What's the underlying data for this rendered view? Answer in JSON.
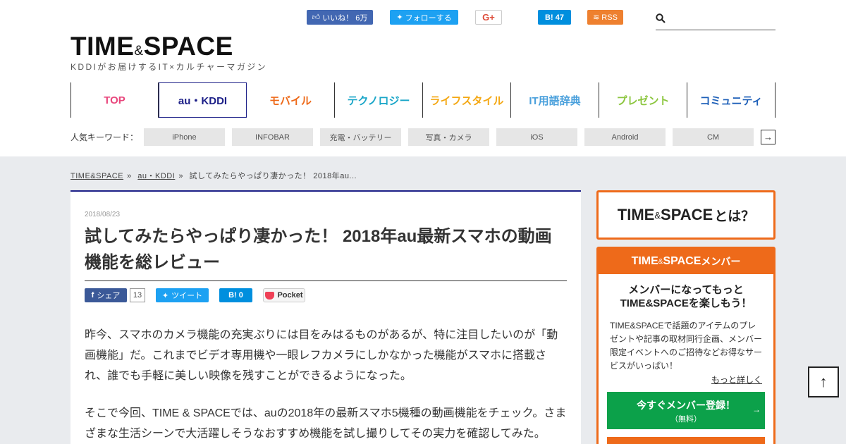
{
  "social_top": {
    "fb_like": "いいね！ 6万",
    "twitter_follow": "フォローする",
    "gplus": "G+",
    "hatena": "B! 47",
    "rss": "RSS"
  },
  "search": {
    "placeholder": ""
  },
  "logo": {
    "part1": "TIME",
    "amp": "&",
    "part2": "SPACE"
  },
  "tagline": "KDDIがお届けするIT×カルチャーマガジン",
  "nav": [
    {
      "label": "TOP",
      "color": "#e8467c"
    },
    {
      "label": "au・KDDI",
      "color": "#1d2088"
    },
    {
      "label": "モバイル",
      "color": "#ee6a1a"
    },
    {
      "label": "テクノロジー",
      "color": "#1aa6c8"
    },
    {
      "label": "ライフスタイル",
      "color": "#f4a814"
    },
    {
      "label": "IT用語辞典",
      "color": "#4aa0dc"
    },
    {
      "label": "プレゼント",
      "color": "#8cc63f"
    },
    {
      "label": "コミュニティ",
      "color": "#1d5fb8"
    }
  ],
  "keywords": {
    "label": "人気キーワード：",
    "tags": [
      "iPhone",
      "INFOBAR",
      "充電・バッテリー",
      "写真・カメラ",
      "iOS",
      "Android",
      "CM"
    ],
    "more": "→"
  },
  "breadcrumb": {
    "home": "TIME&SPACE",
    "category": "au・KDDI",
    "current": "試してみたらやっぱり凄かった！ 2018年au...",
    "sep": "»"
  },
  "article": {
    "date": "2018/08/23",
    "title": "試してみたらやっぱり凄かった！ 2018年au最新スマホの動画機能を総レビュー",
    "share": {
      "fb": "シェア",
      "fb_count": "13",
      "tw": "ツイート",
      "hatena": "B!  0",
      "pocket": "Pocket"
    },
    "paragraphs": [
      "昨今、スマホのカメラ機能の充実ぶりには目をみはるものがあるが、特に注目したいのが「動画機能」だ。これまでビデオ専用機や一眼レフカメラにしかなかった機能がスマホに搭載され、誰でも手軽に美しい映像を残すことができるようになった。",
      "そこで今回、TIME & SPACEでは、auの2018年の最新スマホ5機種の動画機能をチェック。さまざまな生活シーンで大活躍しそうなおすすめ機能を試し撮りしてその実力を確認してみた。"
    ]
  },
  "sidebar": {
    "about": {
      "part1": "TIME",
      "amp": "&",
      "part2": "SPACE",
      "suffix": "とは？"
    },
    "member": {
      "head_part1": "TIME",
      "head_amp": "&",
      "head_part2": "SPACE",
      "head_suffix": " メンバー",
      "lead_line1": "メンバーになってもっと",
      "lead_line2": "TIME&SPACEを楽しもう！",
      "desc": "TIME&SPACEで話題のアイテムのプレゼントや記事の取材同行企画、メンバー限定イベントへのご招待などお得なサービスがいっぱい！",
      "more": "もっと詳しく",
      "register_main": "今すぐメンバー登録！",
      "register_sub": "（無料）",
      "register_arrow": "→"
    }
  },
  "pagetop": "↑"
}
